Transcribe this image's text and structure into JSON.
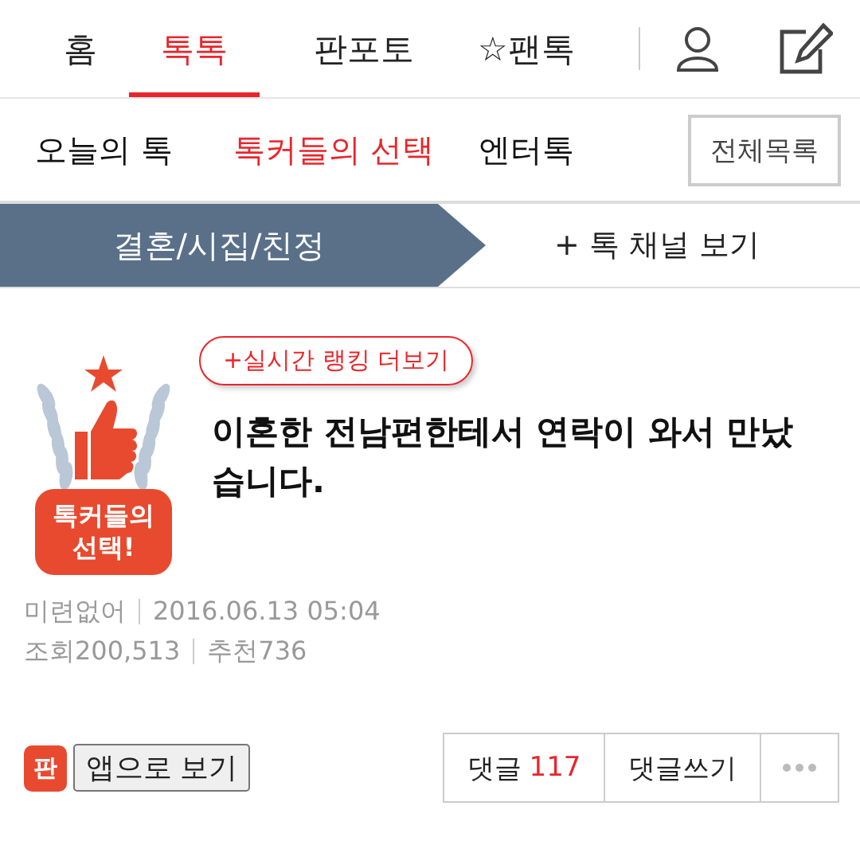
{
  "top_nav": {
    "tabs": [
      {
        "label": "홈",
        "selected": false
      },
      {
        "label": "톡톡",
        "selected": true
      },
      {
        "label": "판포토",
        "selected": false
      },
      {
        "label": "☆팬톡",
        "selected": false
      }
    ]
  },
  "sub_nav": {
    "tabs": [
      {
        "label": "오늘의 톡",
        "selected": false
      },
      {
        "label": "톡커들의 선택",
        "selected": true
      },
      {
        "label": "엔터톡",
        "selected": false
      }
    ],
    "all_button": "전체목록"
  },
  "channel_bar": {
    "current": "결혼/시집/친정",
    "more": "+ 톡 채널 보기"
  },
  "post": {
    "badge_lines": [
      "톡커들의",
      "선택!"
    ],
    "ranking_link": "+실시간 랭킹 더보기",
    "title": "이혼한 전남편한테서 연락이 와서 만났습니다.",
    "author": "미련없어",
    "date": "2016.06.13 05:04",
    "views": "조회200,513",
    "likes": "추천736"
  },
  "actions": {
    "app_icon": "판",
    "app_link": "앱으로 보기",
    "comments_label": "댓글",
    "comments_count": "117",
    "write": "댓글쓰기"
  }
}
